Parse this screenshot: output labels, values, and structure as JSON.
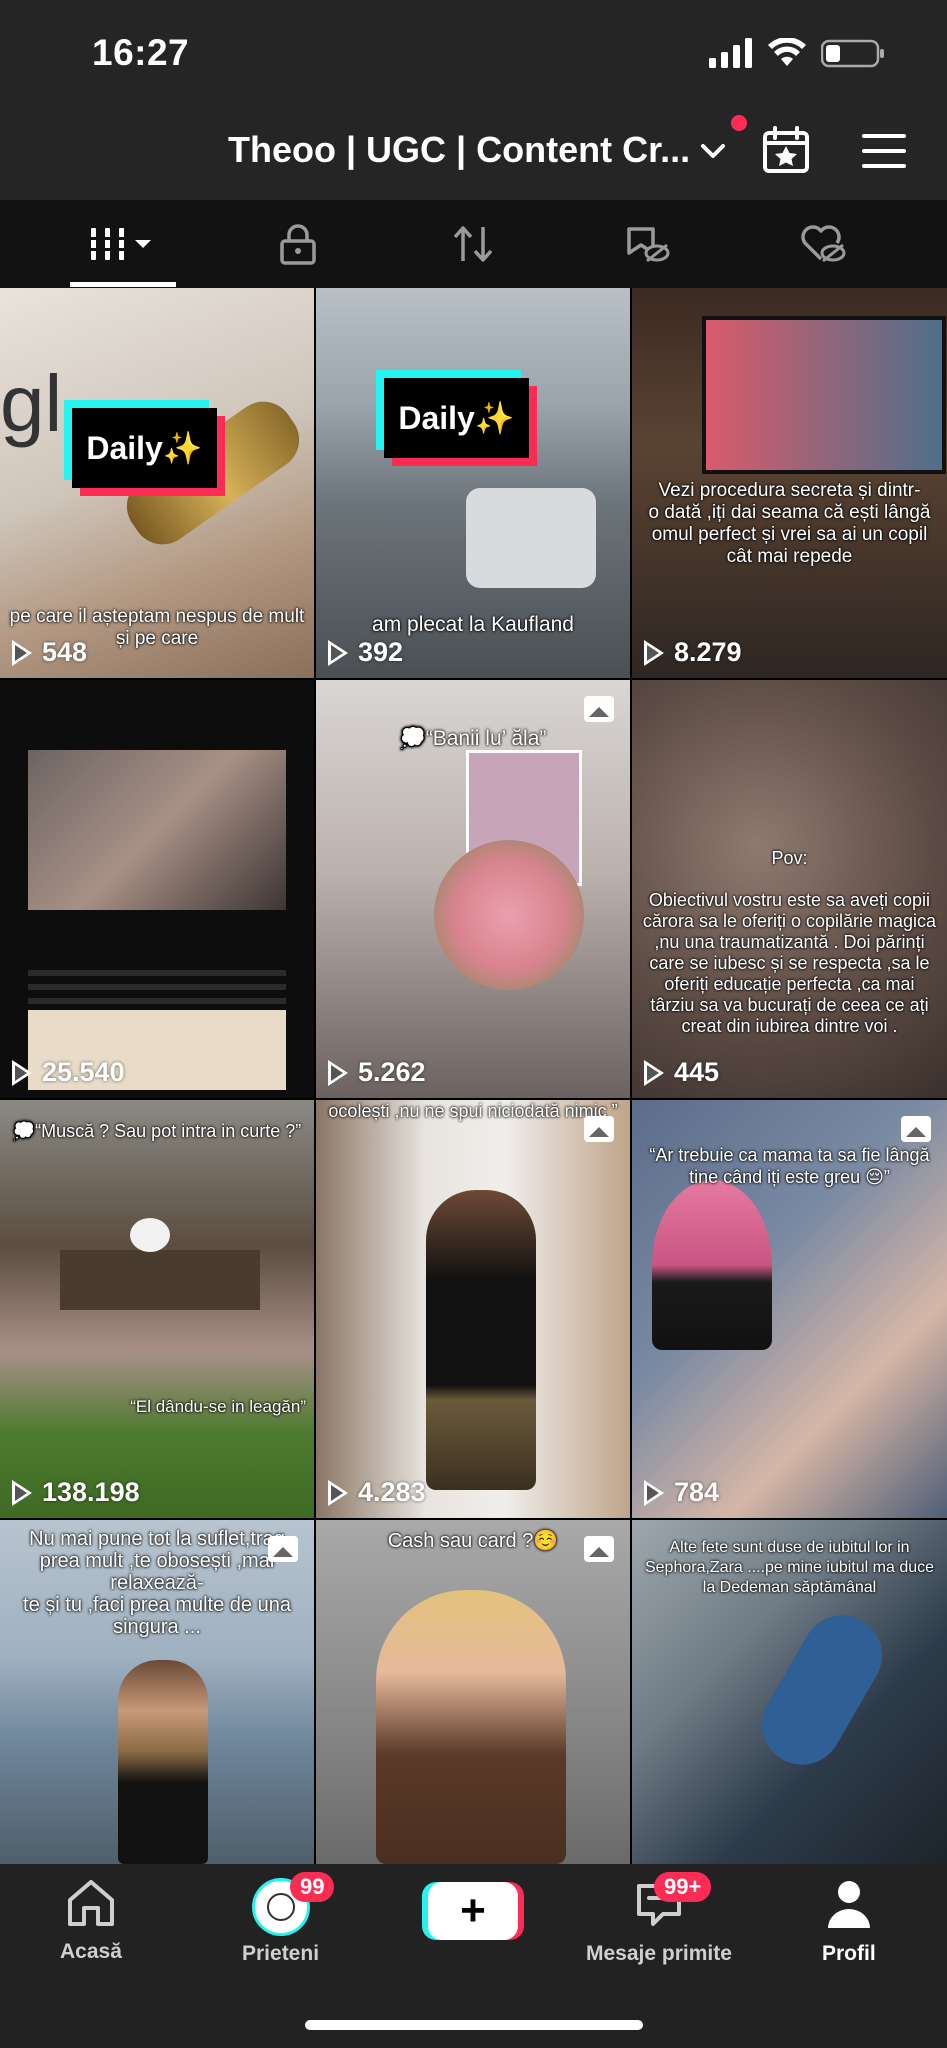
{
  "status_bar": {
    "time": "16:27"
  },
  "header": {
    "account_name": "Theoo | UGC | Content Cr...",
    "icons": [
      "chevron-down-icon",
      "calendar-star-icon",
      "hamburger-menu-icon"
    ]
  },
  "tabs": [
    {
      "name": "videos-grid",
      "icon": "grid-icon"
    },
    {
      "name": "private",
      "icon": "lock-icon"
    },
    {
      "name": "reposts",
      "icon": "repost-icon"
    },
    {
      "name": "favorites",
      "icon": "bookmark-hidden-icon"
    },
    {
      "name": "liked",
      "icon": "heart-hidden-icon"
    }
  ],
  "posts": [
    {
      "views": "548",
      "caption": "pe care il așteptam nespus de mult\nși pe care",
      "overlay": "Daily✨",
      "photo": false
    },
    {
      "views": "392",
      "caption": "am plecat la Kaufland",
      "overlay": "Daily✨",
      "photo": false
    },
    {
      "views": "8.279",
      "caption": "Vezi procedura secreta și dintr-\no dată ,iți dai seama că ești lângă omul perfect și vrei sa ai un copil cât mai repede",
      "photo": false
    },
    {
      "views": "25.540",
      "caption": "",
      "photo": false
    },
    {
      "views": "5.262",
      "caption": "💭“Banii lu’ ăla”",
      "photo": true
    },
    {
      "views": "445",
      "caption": "Pov:\n\nObiectivul vostru este sa aveți copii cărora sa le oferiți o copilărie magica ,nu una traumatizantă . Doi părinți care se iubesc și se respecta ,sa le oferiți educație perfecta ,ca mai târziu sa va bucurați de ceea ce ați creat din iubirea dintre voi .",
      "photo": false
    },
    {
      "views": "138.198",
      "caption": "💭“Muscă ? Sau pot intra in curte ?”",
      "caption2": "“El dându-se in leagăn”",
      "photo": false
    },
    {
      "views": "4.283",
      "caption": "ocolești ,nu ne spui niciodată nimic ”",
      "photo": true
    },
    {
      "views": "784",
      "caption": "“Ar trebuie ca mama ta sa fie lângă tine când iți este greu 😔”",
      "photo": true
    },
    {
      "views": "",
      "caption": "Nu mai pune tot la suflet,trag prea mult ,te obosești ,mai relaxează-\nte și tu ,faci prea multe de una singura ...",
      "photo": true
    },
    {
      "views": "",
      "caption": "Cash sau card ?☺️",
      "photo": true
    },
    {
      "views": "",
      "caption": "Alte fete sunt duse de iubitul lor in Sephora,Zara ....pe mine iubitul ma duce la Dedeman săptămânal",
      "photo": false
    }
  ],
  "bottom_nav": {
    "home": "Acasă",
    "friends": "Prieteni",
    "friends_badge": "99",
    "inbox": "Mesaje primite",
    "inbox_badge": "99+",
    "profile": "Profil"
  }
}
